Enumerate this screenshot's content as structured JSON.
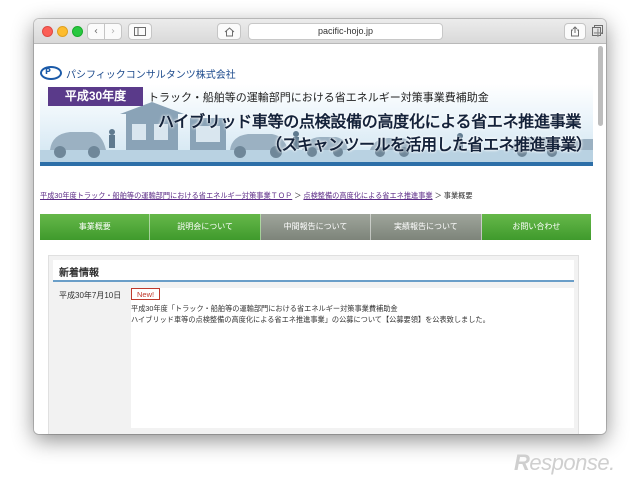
{
  "browser": {
    "url": "pacific-hojo.jp",
    "back_glyph": "‹",
    "forward_glyph": "›",
    "new_tab_glyph": "+"
  },
  "site": {
    "company": "パシフィックコンサルタンツ株式会社",
    "logo_mark": "P"
  },
  "banner": {
    "year": "平成30年度",
    "subtitle": "トラック・船舶等の運輸部門における省エネルギー対策事業費補助金",
    "title_line1": "ハイブリッド車等の点検設備の高度化による省エネ推進事業",
    "title_line2": "（スキャンツールを活用した省エネ推進事業）"
  },
  "breadcrumb": {
    "link1": "平成30年度トラック・船舶等の運輸部門における省エネルギー対策事業ＴＯＰ",
    "sep1": " ＞ ",
    "link2": "点検整備の高度化による省エネ推進事業",
    "sep2": " ＞ ",
    "current": "事業概要"
  },
  "nav": {
    "items": [
      {
        "label": "事業概要"
      },
      {
        "label": "説明会について"
      },
      {
        "label": "中間報告について"
      },
      {
        "label": "実績報告について"
      },
      {
        "label": "お問い合わせ"
      }
    ]
  },
  "news": {
    "heading": "新着情報",
    "date": "平成30年7月10日",
    "badge": "New!",
    "line1": "平成30年度「トラック・船舶等の運輸部門における省エネルギー対策事業費補助金",
    "line2": "ハイブリッド車等の点検整備の高度化による省エネ推進事業」の公募について【公募要領】を公表致しました。"
  },
  "watermark": {
    "r": "R",
    "text": "esponse."
  },
  "colors": {
    "nav_green": "#4fa83a",
    "nav_gray": "#8a9086",
    "year_badge": "#5a3a8a",
    "new_badge": "#c0392b",
    "link": "#5b2a86"
  }
}
